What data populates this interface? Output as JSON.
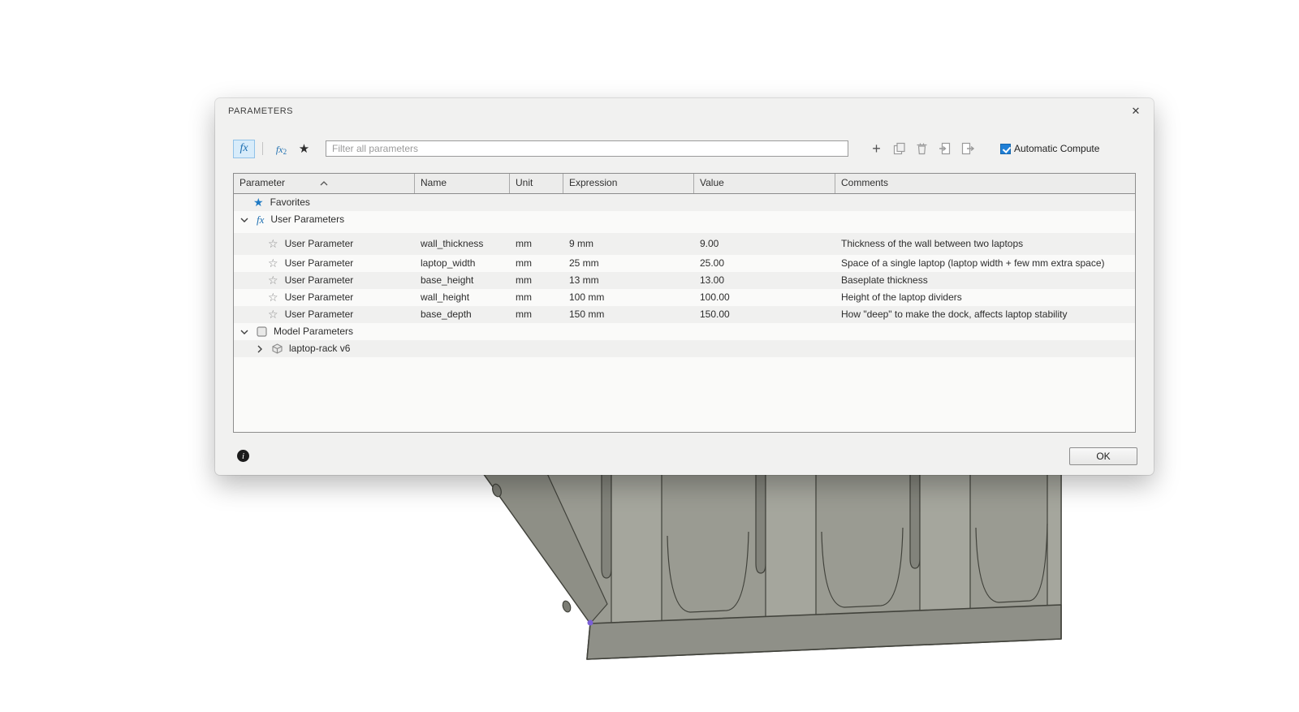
{
  "dialog": {
    "title": "PARAMETERS",
    "close_glyph": "✕",
    "toolbar": {
      "fx_label": "fx",
      "fx2_label": "fx",
      "fx2_sub": "2",
      "star_glyph": "★",
      "filter_placeholder": "Filter all parameters",
      "auto_compute_label": "Automatic Compute",
      "auto_compute_checked": true
    },
    "table": {
      "columns": [
        "Parameter",
        "Name",
        "Unit",
        "Expression",
        "Value",
        "Comments"
      ],
      "favorites_label": "Favorites",
      "user_parameters_label": "User Parameters",
      "model_parameters_label": "Model Parameters",
      "component_label": "laptop-rack v6",
      "rows": [
        {
          "type": "User Parameter",
          "name": "wall_thickness",
          "unit": "mm",
          "expression": "9 mm",
          "value": "9.00",
          "comment": "Thickness of the wall between two laptops"
        },
        {
          "type": "User Parameter",
          "name": "laptop_width",
          "unit": "mm",
          "expression": "25 mm",
          "value": "25.00",
          "comment": "Space of a single laptop (laptop width + few mm extra space)"
        },
        {
          "type": "User Parameter",
          "name": "base_height",
          "unit": "mm",
          "expression": "13 mm",
          "value": "13.00",
          "comment": "Baseplate thickness"
        },
        {
          "type": "User Parameter",
          "name": "wall_height",
          "unit": "mm",
          "expression": "100 mm",
          "value": "100.00",
          "comment": "Height of the laptop dividers"
        },
        {
          "type": "User Parameter",
          "name": "base_depth",
          "unit": "mm",
          "expression": "150 mm",
          "value": "150.00",
          "comment": "How \"deep\" to make the dock, affects laptop stability"
        }
      ]
    },
    "footer": {
      "ok_label": "OK",
      "info_glyph": "i"
    }
  },
  "glyphs": {
    "star_filled": "★",
    "star_outline": "☆",
    "plus": "+",
    "chevron_down": "⌄",
    "chevron_right": "›"
  },
  "colors": {
    "accent_blue": "#1f7fd6",
    "favorite_star_blue": "#1f7ac4",
    "fx_blue": "#1e6fb0",
    "model_gray": "#9a9b92"
  }
}
